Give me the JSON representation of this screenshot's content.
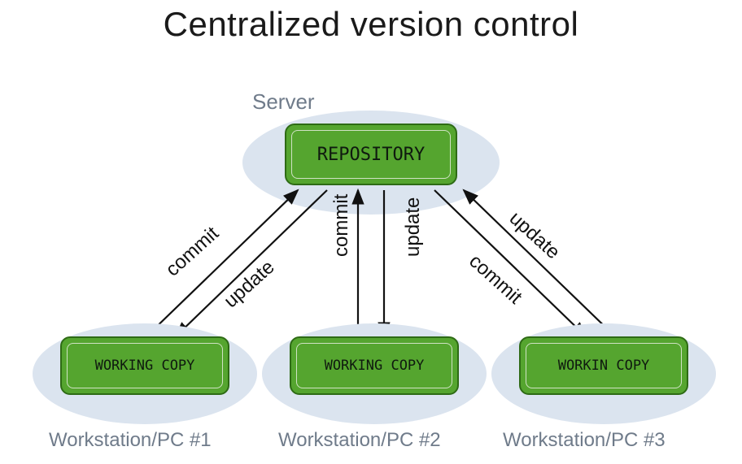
{
  "title": "Centralized version control",
  "server": {
    "label": "Server",
    "node_label": "REPOSITORY"
  },
  "workstations": [
    {
      "label": "Workstation/PC #1",
      "node_label": "WORKING COPY"
    },
    {
      "label": "Workstation/PC #2",
      "node_label": "WORKING COPY"
    },
    {
      "label": "Workstation/PC #3",
      "node_label": "WORKIN COPY"
    }
  ],
  "edges": {
    "commit": "commit",
    "update": "update"
  },
  "colors": {
    "ellipse": "#dbe4ef",
    "node_fill": "#55a52f",
    "node_border": "#2e6b15",
    "muted_text": "#6f7b8a"
  }
}
